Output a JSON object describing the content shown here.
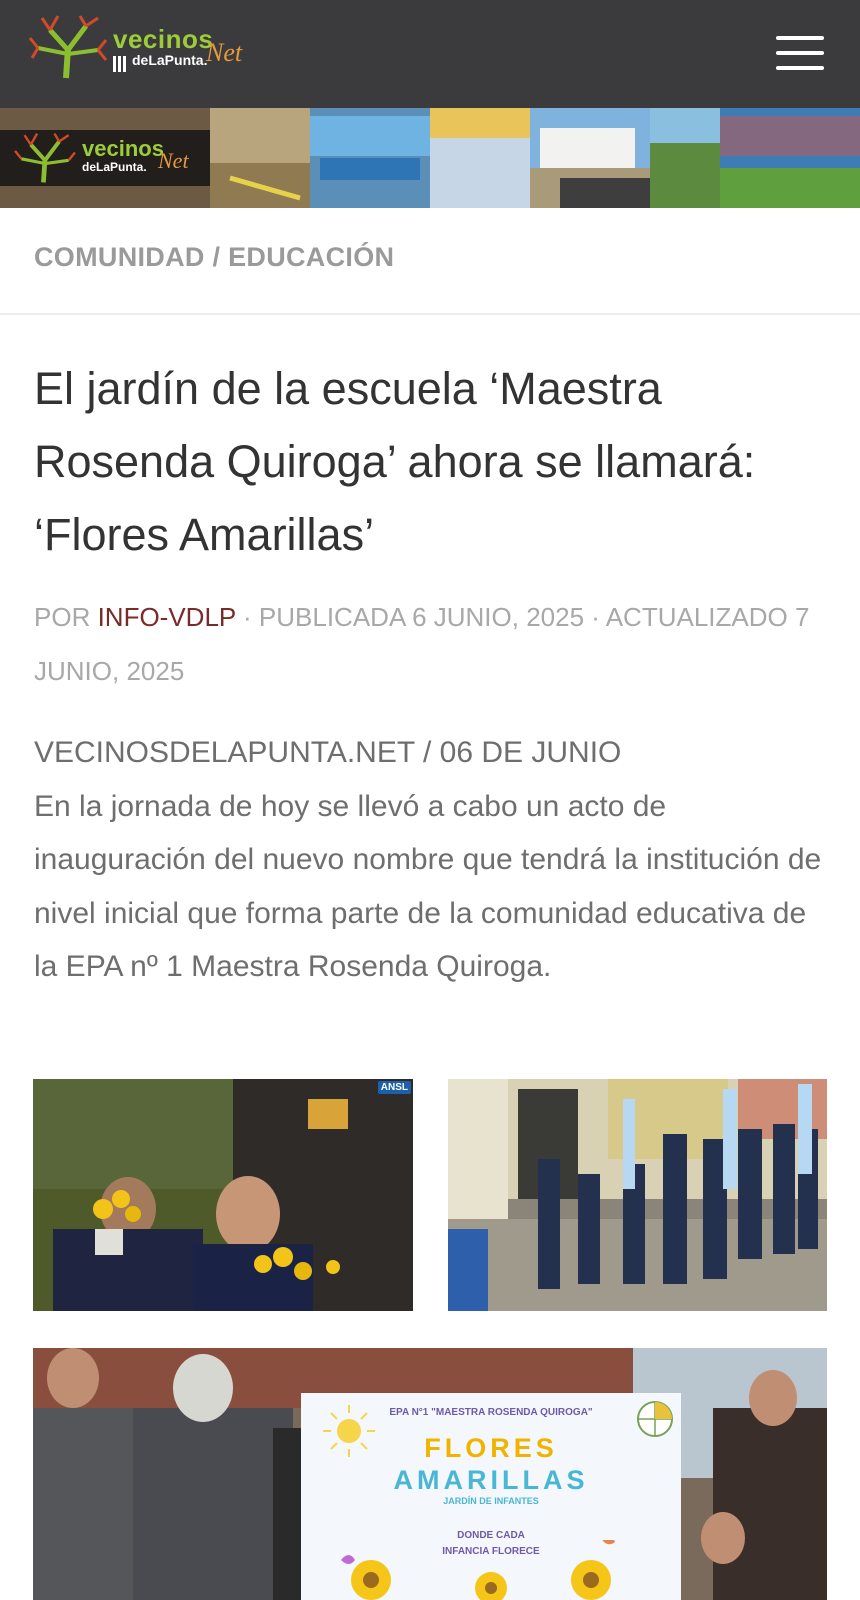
{
  "header": {
    "logo_word": "vecinos",
    "logo_sub": "deLaPunta.",
    "logo_net": "Net",
    "menu_icon": "hamburger-menu-icon"
  },
  "banner": {
    "logo_word": "vecinos",
    "logo_sub": "deLaPunta.",
    "logo_net": "Net"
  },
  "breadcrumb": {
    "category1": "COMUNIDAD",
    "separator": " / ",
    "category2": "EDUCACIÓN"
  },
  "article": {
    "title": "El jardín de la escuela ‘Maestra Rosenda Quiroga’ ahora se llamará: ‘Flores Amarillas’",
    "meta": {
      "by_label": "Por ",
      "author": "info-vdlp",
      "published": " · Publicada 6 junio, 2025 · Actualizado 7 junio, 2025"
    },
    "dateline": "VECINOSDELAPUNTA.NET / 06 DE JUNIO",
    "paragraph": "En la jornada de hoy se llevó a cabo un acto de inauguración del nuevo nombre que tendrá la institución de nivel inicial que forma parte de la comunidad educativa de la EPA nº 1 Maestra Rosenda Quiroga."
  },
  "photos": {
    "p1_badge": "ANSL",
    "sign": {
      "line1": "EPA N°1 \"MAESTRA ROSENDA QUIROGA\"",
      "line2": "FLORES",
      "line3": "AMARILLAS",
      "line4": "JARDÍN DE INFANTES",
      "line5a": "DONDE CADA",
      "line5b": "INFANCIA FLORECE"
    }
  }
}
